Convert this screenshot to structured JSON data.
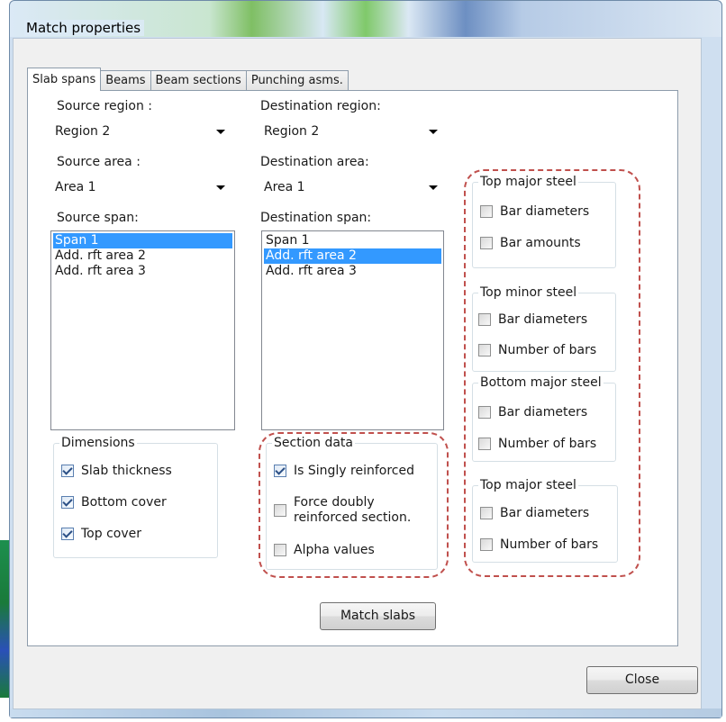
{
  "window": {
    "title": "Match properties"
  },
  "tabs": [
    "Slab spans",
    "Beams",
    "Beam sections",
    "Punching asms."
  ],
  "source": {
    "region_label": "Source region :",
    "region_value": "Region 2",
    "area_label": "Source area :",
    "area_value": "Area 1",
    "span_label": "Source span:",
    "spans": [
      "Span 1",
      "Add. rft area 2",
      "Add. rft area 3"
    ]
  },
  "destination": {
    "region_label": "Destination region:",
    "region_value": "Region 2",
    "area_label": "Destination area:",
    "area_value": "Area 1",
    "span_label": "Destination span:",
    "spans": [
      "Span 1",
      "Add. rft area 2",
      "Add. rft area 3"
    ]
  },
  "dimensions": {
    "title": "Dimensions",
    "slab_thickness": "Slab thickness",
    "bottom_cover": "Bottom cover",
    "top_cover": "Top cover"
  },
  "section_data": {
    "title": "Section data",
    "singly": "Is Singly reinforced",
    "force_doubly_1": "Force doubly",
    "force_doubly_2": "reinforced section.",
    "alpha": "Alpha values"
  },
  "steel": [
    {
      "title": "Top major steel",
      "opt1": "Bar diameters",
      "opt2": "Bar amounts"
    },
    {
      "title": "Top minor steel",
      "opt1": "Bar diameters",
      "opt2": "Number of bars"
    },
    {
      "title": "Bottom major steel",
      "opt1": "Bar diameters",
      "opt2": "Number of bars"
    },
    {
      "title": "Top major steel",
      "opt1": "Bar diameters",
      "opt2": "Number of bars"
    }
  ],
  "buttons": {
    "match": "Match slabs",
    "close": "Close"
  },
  "colors": {
    "selection": "#3399ff",
    "highlight_dashed": "#c0504d"
  }
}
